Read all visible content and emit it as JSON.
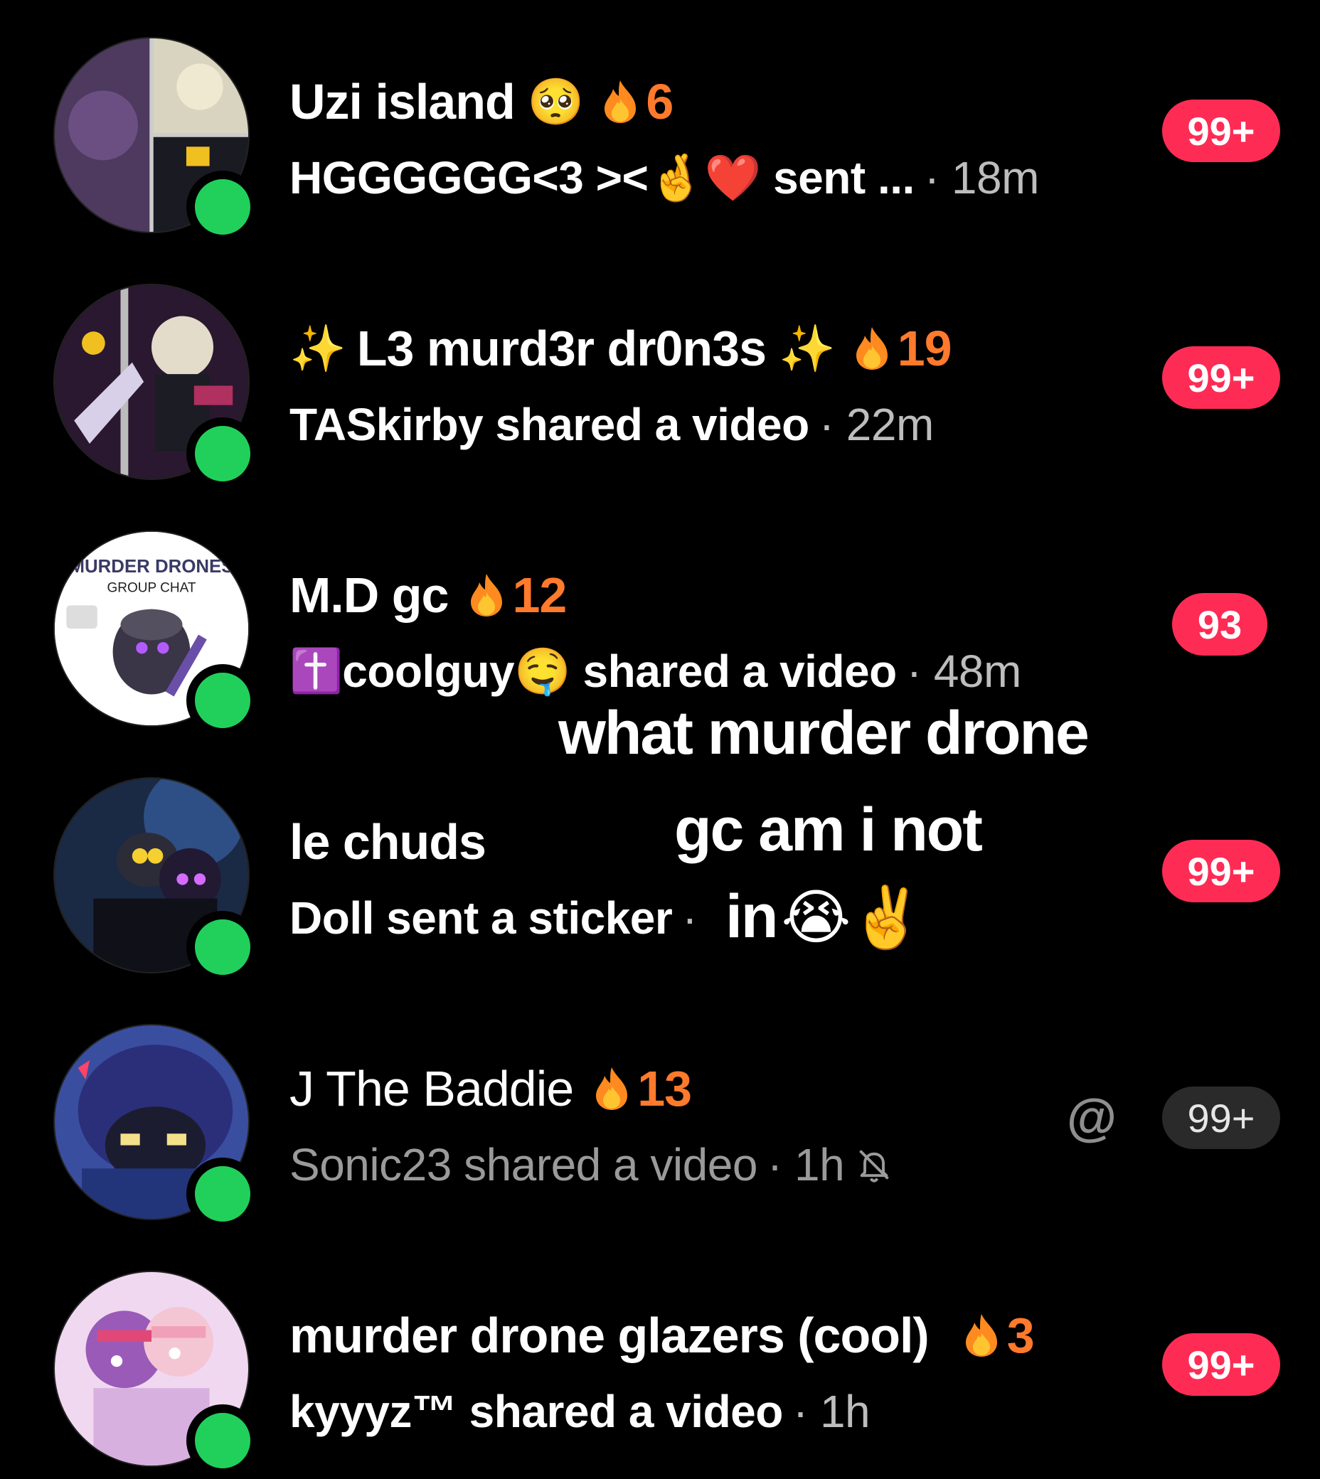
{
  "chats": [
    {
      "title": "Uzi island",
      "title_emoji": "🥺",
      "streak": "6",
      "preview": "HGGGGGG<3 ><🤞❤️ sent ...",
      "time": "· 18m",
      "badge": "99+",
      "badge_style": "red"
    },
    {
      "title": "L3 murd3r dr0n3s",
      "title_prefix_emoji": "✨",
      "title_suffix_emoji": "✨",
      "streak": "19",
      "preview": "TASkirby shared a video",
      "time": "· 22m",
      "badge": "99+",
      "badge_style": "red"
    },
    {
      "title": "M.D gc",
      "streak": "12",
      "preview_emoji": "✝️",
      "preview": "coolguy🤤 shared a video",
      "time": "· 48m",
      "badge": "93",
      "badge_style": "red",
      "avatar_text_top": "MURDER DRONES",
      "avatar_text_sub": "GROUP CHAT"
    },
    {
      "title": "le chuds",
      "preview": "Doll sent a sticker",
      "time": "·",
      "badge": "99+",
      "badge_style": "red"
    },
    {
      "title": "J The Baddie",
      "streak": "13",
      "preview": "Sonic23 shared a video",
      "time": "· 1h",
      "badge": "99+",
      "badge_style": "gray",
      "mention_icon": "at-icon",
      "muted_icon": "bell-off-icon"
    },
    {
      "title": "murder drone glazers (cool)",
      "streak": "3",
      "preview": "kyyyz™ shared a video",
      "time": "· 1h",
      "badge": "99+",
      "badge_style": "red"
    }
  ],
  "overlay": {
    "line1": "what murder drone",
    "line2": "gc am i not",
    "line3": "in",
    "line3_emoji": "😭✌️"
  },
  "icons": {
    "online": "online-dot-icon",
    "streak": "flame-icon",
    "mention": "@"
  },
  "colors": {
    "background": "#000000",
    "badge_red": "#fe2c55",
    "badge_gray": "#2a2a2a",
    "online_green": "#21d05a",
    "streak_orange": "#ff7a2c",
    "time_gray": "#bdbdbd"
  }
}
